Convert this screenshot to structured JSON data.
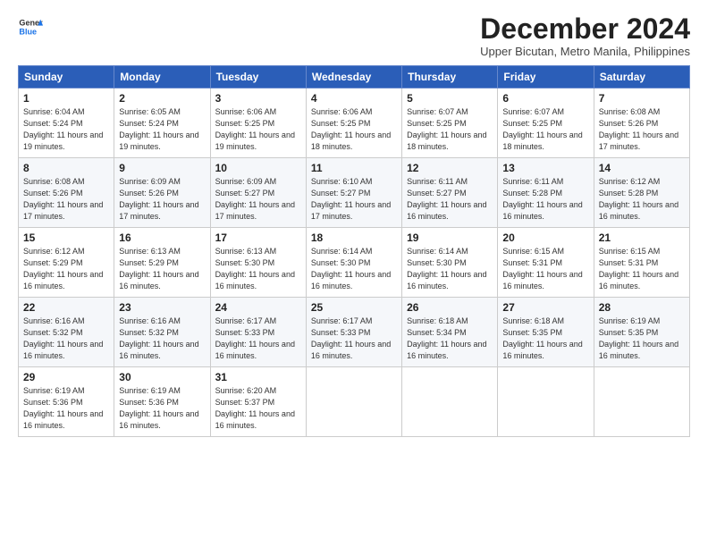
{
  "logo": {
    "line1": "General",
    "line2": "Blue"
  },
  "title": "December 2024",
  "subtitle": "Upper Bicutan, Metro Manila, Philippines",
  "days_of_week": [
    "Sunday",
    "Monday",
    "Tuesday",
    "Wednesday",
    "Thursday",
    "Friday",
    "Saturday"
  ],
  "weeks": [
    [
      {
        "day": "1",
        "sunrise": "6:04 AM",
        "sunset": "5:24 PM",
        "daylight": "11 hours and 19 minutes."
      },
      {
        "day": "2",
        "sunrise": "6:05 AM",
        "sunset": "5:24 PM",
        "daylight": "11 hours and 19 minutes."
      },
      {
        "day": "3",
        "sunrise": "6:06 AM",
        "sunset": "5:25 PM",
        "daylight": "11 hours and 19 minutes."
      },
      {
        "day": "4",
        "sunrise": "6:06 AM",
        "sunset": "5:25 PM",
        "daylight": "11 hours and 18 minutes."
      },
      {
        "day": "5",
        "sunrise": "6:07 AM",
        "sunset": "5:25 PM",
        "daylight": "11 hours and 18 minutes."
      },
      {
        "day": "6",
        "sunrise": "6:07 AM",
        "sunset": "5:25 PM",
        "daylight": "11 hours and 18 minutes."
      },
      {
        "day": "7",
        "sunrise": "6:08 AM",
        "sunset": "5:26 PM",
        "daylight": "11 hours and 17 minutes."
      }
    ],
    [
      {
        "day": "8",
        "sunrise": "6:08 AM",
        "sunset": "5:26 PM",
        "daylight": "11 hours and 17 minutes."
      },
      {
        "day": "9",
        "sunrise": "6:09 AM",
        "sunset": "5:26 PM",
        "daylight": "11 hours and 17 minutes."
      },
      {
        "day": "10",
        "sunrise": "6:09 AM",
        "sunset": "5:27 PM",
        "daylight": "11 hours and 17 minutes."
      },
      {
        "day": "11",
        "sunrise": "6:10 AM",
        "sunset": "5:27 PM",
        "daylight": "11 hours and 17 minutes."
      },
      {
        "day": "12",
        "sunrise": "6:11 AM",
        "sunset": "5:27 PM",
        "daylight": "11 hours and 16 minutes."
      },
      {
        "day": "13",
        "sunrise": "6:11 AM",
        "sunset": "5:28 PM",
        "daylight": "11 hours and 16 minutes."
      },
      {
        "day": "14",
        "sunrise": "6:12 AM",
        "sunset": "5:28 PM",
        "daylight": "11 hours and 16 minutes."
      }
    ],
    [
      {
        "day": "15",
        "sunrise": "6:12 AM",
        "sunset": "5:29 PM",
        "daylight": "11 hours and 16 minutes."
      },
      {
        "day": "16",
        "sunrise": "6:13 AM",
        "sunset": "5:29 PM",
        "daylight": "11 hours and 16 minutes."
      },
      {
        "day": "17",
        "sunrise": "6:13 AM",
        "sunset": "5:30 PM",
        "daylight": "11 hours and 16 minutes."
      },
      {
        "day": "18",
        "sunrise": "6:14 AM",
        "sunset": "5:30 PM",
        "daylight": "11 hours and 16 minutes."
      },
      {
        "day": "19",
        "sunrise": "6:14 AM",
        "sunset": "5:30 PM",
        "daylight": "11 hours and 16 minutes."
      },
      {
        "day": "20",
        "sunrise": "6:15 AM",
        "sunset": "5:31 PM",
        "daylight": "11 hours and 16 minutes."
      },
      {
        "day": "21",
        "sunrise": "6:15 AM",
        "sunset": "5:31 PM",
        "daylight": "11 hours and 16 minutes."
      }
    ],
    [
      {
        "day": "22",
        "sunrise": "6:16 AM",
        "sunset": "5:32 PM",
        "daylight": "11 hours and 16 minutes."
      },
      {
        "day": "23",
        "sunrise": "6:16 AM",
        "sunset": "5:32 PM",
        "daylight": "11 hours and 16 minutes."
      },
      {
        "day": "24",
        "sunrise": "6:17 AM",
        "sunset": "5:33 PM",
        "daylight": "11 hours and 16 minutes."
      },
      {
        "day": "25",
        "sunrise": "6:17 AM",
        "sunset": "5:33 PM",
        "daylight": "11 hours and 16 minutes."
      },
      {
        "day": "26",
        "sunrise": "6:18 AM",
        "sunset": "5:34 PM",
        "daylight": "11 hours and 16 minutes."
      },
      {
        "day": "27",
        "sunrise": "6:18 AM",
        "sunset": "5:35 PM",
        "daylight": "11 hours and 16 minutes."
      },
      {
        "day": "28",
        "sunrise": "6:19 AM",
        "sunset": "5:35 PM",
        "daylight": "11 hours and 16 minutes."
      }
    ],
    [
      {
        "day": "29",
        "sunrise": "6:19 AM",
        "sunset": "5:36 PM",
        "daylight": "11 hours and 16 minutes."
      },
      {
        "day": "30",
        "sunrise": "6:19 AM",
        "sunset": "5:36 PM",
        "daylight": "11 hours and 16 minutes."
      },
      {
        "day": "31",
        "sunrise": "6:20 AM",
        "sunset": "5:37 PM",
        "daylight": "11 hours and 16 minutes."
      },
      null,
      null,
      null,
      null
    ]
  ]
}
